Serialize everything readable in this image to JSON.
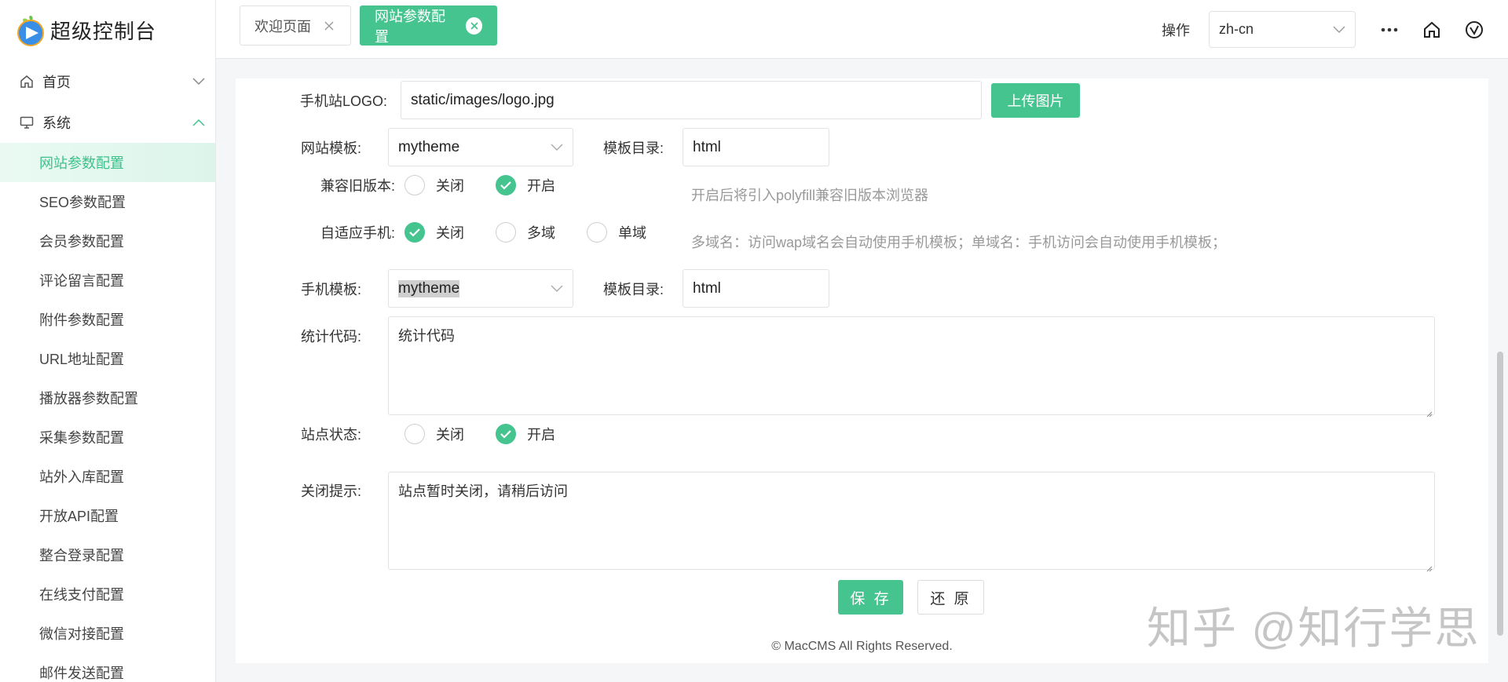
{
  "app": {
    "title": "超级控制台"
  },
  "sidebar": {
    "groups": [
      {
        "label": "首页",
        "icon": "home-icon",
        "expanded": false
      },
      {
        "label": "系统",
        "icon": "monitor-icon",
        "expanded": true
      }
    ],
    "items": [
      {
        "label": "网站参数配置",
        "active": true
      },
      {
        "label": "SEO参数配置"
      },
      {
        "label": "会员参数配置"
      },
      {
        "label": "评论留言配置"
      },
      {
        "label": "附件参数配置"
      },
      {
        "label": "URL地址配置"
      },
      {
        "label": "播放器参数配置"
      },
      {
        "label": "采集参数配置"
      },
      {
        "label": "站外入库配置"
      },
      {
        "label": "开放API配置"
      },
      {
        "label": "整合登录配置"
      },
      {
        "label": "在线支付配置"
      },
      {
        "label": "微信对接配置"
      },
      {
        "label": "邮件发送配置"
      }
    ]
  },
  "tabs": [
    {
      "label": "欢迎页面",
      "active": false
    },
    {
      "label": "网站参数配置",
      "active": true
    }
  ],
  "topbar": {
    "operate_label": "操作",
    "language_value": "zh-cn"
  },
  "form": {
    "logo": {
      "label": "手机站LOGO:",
      "value": "static/images/logo.jpg",
      "upload_label": "上传图片"
    },
    "template": {
      "label": "网站模板:",
      "value": "mytheme",
      "dir_label": "模板目录:",
      "dir_value": "html"
    },
    "compat": {
      "label": "兼容旧版本:",
      "options": [
        "关闭",
        "开启"
      ],
      "selected": "开启",
      "hint": "开启后将引入polyfill兼容旧版本浏览器"
    },
    "adaptive": {
      "label": "自适应手机:",
      "options": [
        "关闭",
        "多域",
        "单域"
      ],
      "selected": "关闭",
      "hint": "多域名：访问wap域名会自动使用手机模板；单域名：手机访问会自动使用手机模板；"
    },
    "mobile_template": {
      "label": "手机模板:",
      "value": "mytheme",
      "dir_label": "模板目录:",
      "dir_value": "html"
    },
    "stats": {
      "label": "统计代码:",
      "value": "统计代码"
    },
    "status": {
      "label": "站点状态:",
      "options": [
        "关闭",
        "开启"
      ],
      "selected": "开启"
    },
    "close_tip": {
      "label": "关闭提示:",
      "value": "站点暂时关闭，请稍后访问"
    },
    "save_label": "保 存",
    "reset_label": "还 原"
  },
  "footer": {
    "text": "© MacCMS All Rights Reserved."
  },
  "watermark": {
    "text": "知乎 @知行学思"
  },
  "colors": {
    "accent": "#45c48f",
    "hint": "#999999"
  }
}
